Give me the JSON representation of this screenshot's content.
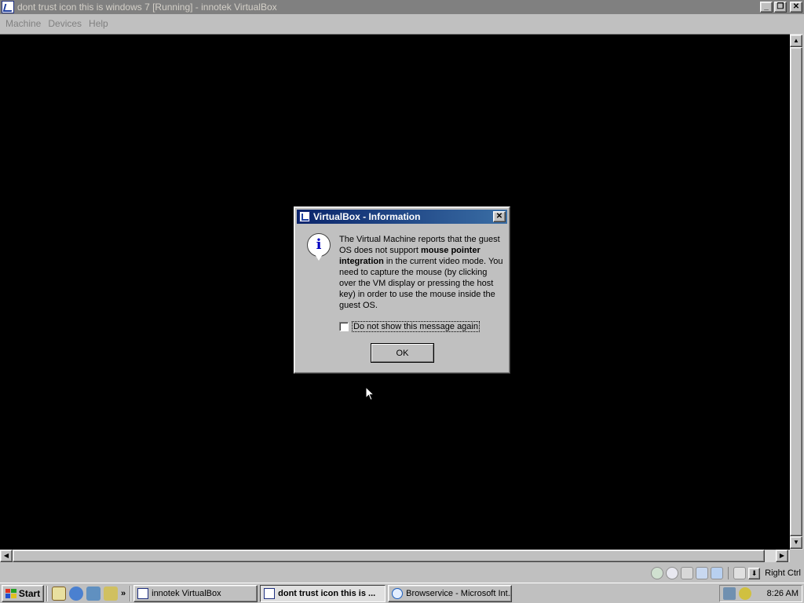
{
  "window": {
    "title": "dont trust icon this is windows 7 [Running] - innotek VirtualBox",
    "caption_minimize": "_",
    "caption_maximize": "❐",
    "caption_close": "✕"
  },
  "menu": {
    "items": [
      {
        "label": "Machine"
      },
      {
        "label": "Devices"
      },
      {
        "label": "Help"
      }
    ]
  },
  "dialog": {
    "title": "VirtualBox - Information",
    "close": "✕",
    "icon_letter": "i",
    "text_1": "The Virtual Machine reports that the guest OS does not support ",
    "text_bold": "mouse pointer integration",
    "text_2": " in the current video mode. You need to capture the mouse (by clicking over the VM display or pressing the host key) in order to use the mouse inside the guest OS.",
    "checkbox_label": "Do not show this message again",
    "checkbox_checked": false,
    "ok_label": "OK"
  },
  "scroll": {
    "up": "▲",
    "down": "▼",
    "left": "◀",
    "right": "▶"
  },
  "status": {
    "host_key_arrow": "⬇",
    "host_key": "Right Ctrl",
    "icons": [
      "hard-disk-icon",
      "cd-icon",
      "floppy-icon",
      "network-icon",
      "shared-folder-icon",
      "usb-icon"
    ]
  },
  "taskbar": {
    "start_label": "Start",
    "quick_launch_more": "»",
    "tasks": [
      {
        "label": "innotek VirtualBox",
        "active": false
      },
      {
        "label": "dont trust icon this is ...",
        "active": true
      },
      {
        "label": "Browservice - Microsoft Int...",
        "active": false
      }
    ],
    "clock": "8:26 AM"
  },
  "colors": {
    "title_inactive": "#808080",
    "dialog_title_start": "#0a246a",
    "dialog_title_end": "#3a6ea5",
    "vm_background": "#000000",
    "chrome": "#c0c0c0"
  }
}
